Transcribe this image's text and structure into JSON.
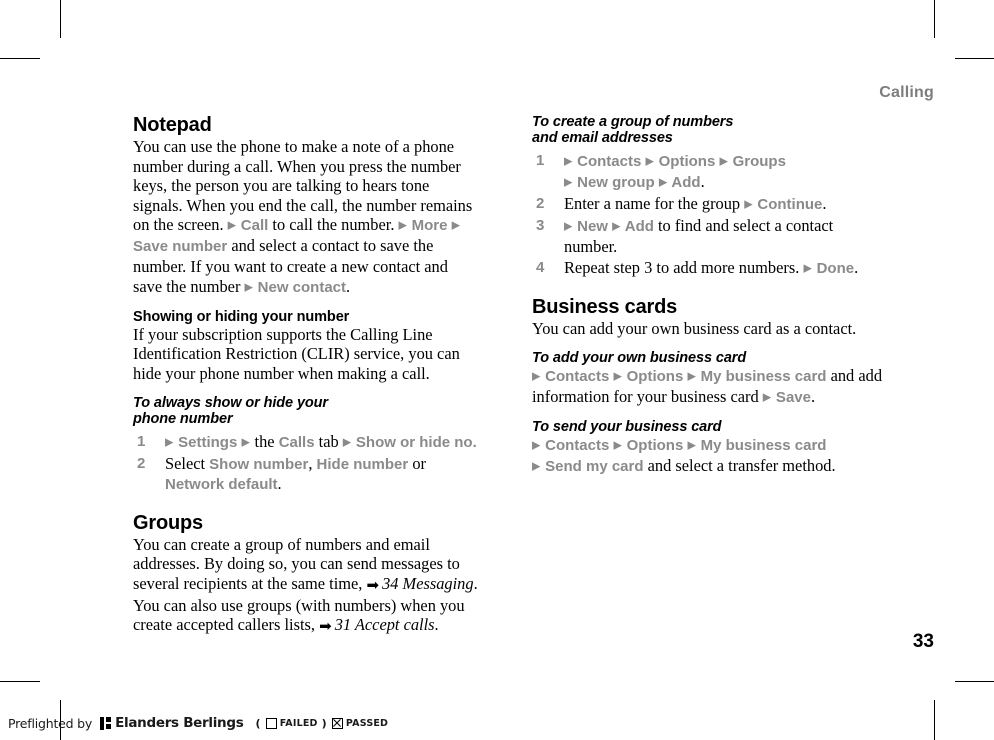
{
  "page": {
    "running_head": "Calling",
    "folio": "33"
  },
  "left_column": [
    {
      "type": "section_heading",
      "name": "notepad",
      "text": "Notepad"
    },
    {
      "type": "paragraph",
      "name": "notepad-body",
      "runs": [
        {
          "style": "serif",
          "text": "You can use the phone to make a note of a phone number during a call. When you press the number keys, the person you are talking to hears tone signals. When you end the call, the number remains on the screen. "
        },
        {
          "style": "arrow",
          "text": "▶"
        },
        {
          "style": "ui",
          "text": " Call"
        },
        {
          "style": "serif",
          "text": " to call the number. "
        },
        {
          "style": "arrow",
          "text": "▶"
        },
        {
          "style": "ui",
          "text": " More "
        },
        {
          "style": "arrow",
          "text": "▶"
        },
        {
          "style": "ui",
          "text": " Save number"
        },
        {
          "style": "serif",
          "text": " and select a contact to save the number. If you want to create a new contact and save the number "
        },
        {
          "style": "arrow",
          "text": "▶"
        },
        {
          "style": "ui",
          "text": " New contact"
        },
        {
          "style": "serif",
          "text": "."
        }
      ]
    },
    {
      "type": "sub_heading",
      "name": "showing-or-hiding-your-number",
      "text": "Showing or hiding your number"
    },
    {
      "type": "paragraph",
      "name": "clir-body",
      "runs": [
        {
          "style": "serif",
          "text": "If your subscription supports the Calling Line Identification Restriction (CLIR) service, you can hide your phone number when making a call."
        }
      ]
    },
    {
      "type": "task_heading",
      "name": "to-always-show-or-hide-your-phone-number",
      "lines": [
        "To always show or hide your",
        "phone number"
      ]
    },
    {
      "type": "steps",
      "name": "show-hide-number-steps",
      "items": [
        {
          "number": "1",
          "runs": [
            {
              "style": "arrow",
              "text": "▶"
            },
            {
              "style": "ui",
              "text": " Settings "
            },
            {
              "style": "arrow",
              "text": "▶"
            },
            {
              "style": "serif",
              "text": " the "
            },
            {
              "style": "ui",
              "text": "Calls"
            },
            {
              "style": "serif",
              "text": " tab "
            },
            {
              "style": "arrow",
              "text": "▶"
            },
            {
              "style": "ui",
              "text": " Show or hide no."
            }
          ]
        },
        {
          "number": "2",
          "runs": [
            {
              "style": "serif",
              "text": "Select "
            },
            {
              "style": "ui",
              "text": "Show number"
            },
            {
              "style": "serif",
              "text": ", "
            },
            {
              "style": "ui",
              "text": "Hide number"
            },
            {
              "style": "serif",
              "text": " or "
            },
            {
              "style": "ui",
              "text": "Network default"
            },
            {
              "style": "serif",
              "text": "."
            }
          ]
        }
      ]
    },
    {
      "type": "section_heading",
      "name": "groups",
      "text": "Groups"
    },
    {
      "type": "paragraph",
      "name": "groups-body",
      "runs": [
        {
          "style": "serif",
          "text": "You can create a group of numbers and email addresses. By doing so, you can send messages to several recipients at the same time, "
        },
        {
          "style": "xref",
          "text": "➡"
        },
        {
          "style": "italic",
          "text": "34 Messaging"
        },
        {
          "style": "serif",
          "text": ". You can also use groups (with numbers) when you create accepted callers lists, "
        },
        {
          "style": "xref",
          "text": "➡"
        },
        {
          "style": "italic",
          "text": "31 Accept calls"
        },
        {
          "style": "serif",
          "text": "."
        }
      ]
    }
  ],
  "right_column": [
    {
      "type": "task_heading",
      "name": "to-create-a-group-of-numbers-and-email-addresses",
      "lines": [
        "To create a group of numbers",
        "and email addresses"
      ]
    },
    {
      "type": "steps",
      "name": "create-group-steps",
      "items": [
        {
          "number": "1",
          "runs": [
            {
              "style": "arrow",
              "text": "▶"
            },
            {
              "style": "ui",
              "text": " Contacts "
            },
            {
              "style": "arrow",
              "text": "▶"
            },
            {
              "style": "ui",
              "text": " Options "
            },
            {
              "style": "arrow",
              "text": "▶"
            },
            {
              "style": "ui",
              "text": " Groups"
            },
            {
              "style": "break",
              "text": ""
            },
            {
              "style": "arrow",
              "text": "▶"
            },
            {
              "style": "ui",
              "text": " New group "
            },
            {
              "style": "arrow",
              "text": "▶"
            },
            {
              "style": "ui",
              "text": " Add"
            },
            {
              "style": "serif",
              "text": "."
            }
          ]
        },
        {
          "number": "2",
          "runs": [
            {
              "style": "serif",
              "text": "Enter a name for the group "
            },
            {
              "style": "arrow",
              "text": "▶"
            },
            {
              "style": "ui",
              "text": " Continue"
            },
            {
              "style": "serif",
              "text": "."
            }
          ]
        },
        {
          "number": "3",
          "runs": [
            {
              "style": "arrow",
              "text": "▶"
            },
            {
              "style": "ui",
              "text": " New "
            },
            {
              "style": "arrow",
              "text": "▶"
            },
            {
              "style": "ui",
              "text": " Add"
            },
            {
              "style": "serif",
              "text": " to find and select a contact number."
            }
          ]
        },
        {
          "number": "4",
          "runs": [
            {
              "style": "serif",
              "text": "Repeat step 3 to add more numbers. "
            },
            {
              "style": "arrow",
              "text": "▶"
            },
            {
              "style": "ui",
              "text": " Done"
            },
            {
              "style": "serif",
              "text": "."
            }
          ]
        }
      ]
    },
    {
      "type": "section_heading",
      "name": "business-cards",
      "text": "Business cards"
    },
    {
      "type": "paragraph",
      "name": "business-cards-body",
      "runs": [
        {
          "style": "serif",
          "text": "You can add your own business card as a contact."
        }
      ]
    },
    {
      "type": "task_heading",
      "name": "to-add-your-own-business-card",
      "lines": [
        "To add your own business card"
      ]
    },
    {
      "type": "paragraph",
      "name": "add-business-card-body",
      "runs": [
        {
          "style": "arrow",
          "text": "▶"
        },
        {
          "style": "ui",
          "text": " Contacts "
        },
        {
          "style": "arrow",
          "text": "▶"
        },
        {
          "style": "ui",
          "text": " Options "
        },
        {
          "style": "arrow",
          "text": "▶"
        },
        {
          "style": "ui",
          "text": " My business card"
        },
        {
          "style": "serif",
          "text": " and add information for your business card "
        },
        {
          "style": "arrow",
          "text": "▶"
        },
        {
          "style": "ui",
          "text": " Save"
        },
        {
          "style": "serif",
          "text": "."
        }
      ]
    },
    {
      "type": "task_heading",
      "name": "to-send-your-business-card",
      "lines": [
        "To send your business card"
      ]
    },
    {
      "type": "paragraph",
      "name": "send-business-card-body",
      "runs": [
        {
          "style": "arrow",
          "text": "▶"
        },
        {
          "style": "ui",
          "text": " Contacts "
        },
        {
          "style": "arrow",
          "text": "▶"
        },
        {
          "style": "ui",
          "text": " Options "
        },
        {
          "style": "arrow",
          "text": "▶"
        },
        {
          "style": "ui",
          "text": " My business card"
        },
        {
          "style": "break",
          "text": ""
        },
        {
          "style": "arrow",
          "text": "▶"
        },
        {
          "style": "ui",
          "text": " Send my card"
        },
        {
          "style": "serif",
          "text": " and select a transfer method."
        }
      ]
    }
  ],
  "preflight": {
    "prefix": "Preflighted by",
    "brand": "Elanders Berlings",
    "open_paren": "(",
    "failed_label": "FAILED",
    "close_paren": ")",
    "passed_label": "PASSED",
    "failed_checked": false,
    "passed_checked": true
  },
  "colors": {
    "ui_term_gray": "#8a8a8a",
    "running_head_gray": "#7d7d7d",
    "text_black": "#000000",
    "paper": "#ffffff"
  }
}
